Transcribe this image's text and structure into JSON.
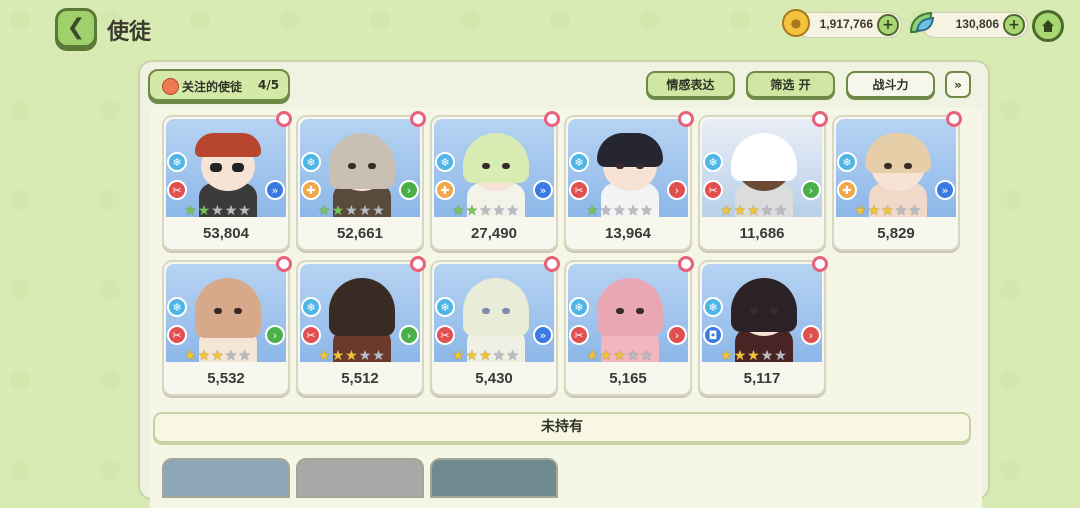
{
  "header": {
    "title": "使徒",
    "gold_amount": "1,917,766",
    "leaf_amount": "130,806",
    "plus_label": "+"
  },
  "filter_bar": {
    "favorites_label": "关注的使徒",
    "favorites_count": "4/5",
    "emotion_label": "情感表达",
    "filter_label": "筛选 开",
    "sort_label": "战斗力",
    "expand_label": "»"
  },
  "cards": [
    {
      "power": "53,804",
      "stars": 2
    },
    {
      "power": "52,661",
      "stars": 2
    },
    {
      "power": "27,490",
      "stars": 2
    },
    {
      "power": "13,964",
      "stars": 1
    },
    {
      "power": "11,686",
      "stars": 3
    },
    {
      "power": "5,829",
      "stars": 3
    },
    {
      "power": "5,532",
      "stars": 3
    },
    {
      "power": "5,512",
      "stars": 3
    },
    {
      "power": "5,430",
      "stars": 3
    },
    {
      "power": "5,165",
      "stars": 3
    },
    {
      "power": "5,117",
      "stars": 3
    }
  ],
  "unowned_label": "未持有",
  "colors": {
    "background": "#d8ebb4",
    "accent_green": "#9fd06c",
    "star_filled": "#f4c431",
    "star_green": "#74c553",
    "star_empty": "#b9bcc4"
  }
}
